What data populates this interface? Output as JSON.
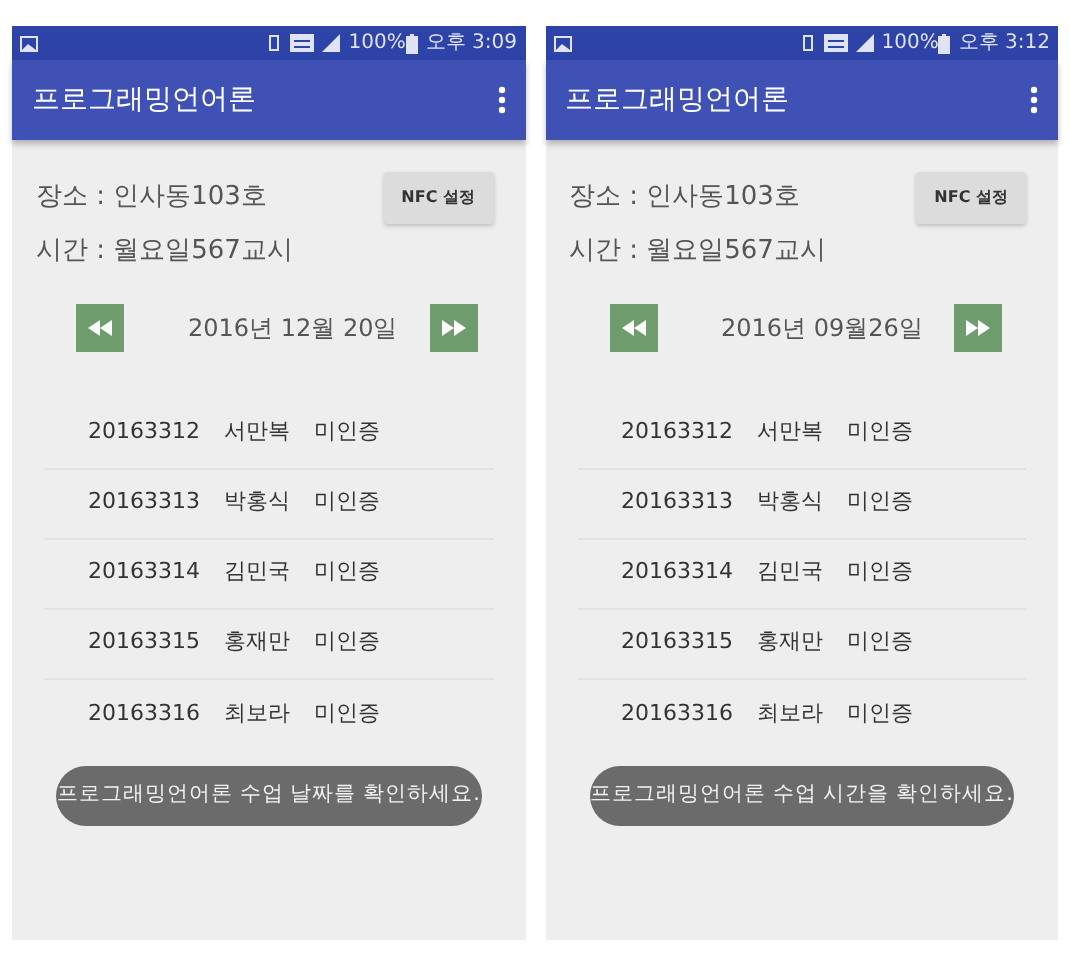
{
  "phones": [
    {
      "status_bar": {
        "battery": "100%",
        "time": "오후 3:09"
      },
      "app_bar": {
        "title": "프로그래밍언어론"
      },
      "place": "장소 : 인사동103호",
      "time": "시간 : 월요일567교시",
      "nfc_button": "NFC 설정",
      "date": "2016년 12월 20일",
      "students": [
        {
          "id": "20163312",
          "name": "서만복",
          "status": "미인증"
        },
        {
          "id": "20163313",
          "name": "박홍식",
          "status": "미인증"
        },
        {
          "id": "20163314",
          "name": "김민국",
          "status": "미인증"
        },
        {
          "id": "20163315",
          "name": "홍재만",
          "status": "미인증"
        },
        {
          "id": "20163316",
          "name": "최보라",
          "status": "미인증"
        }
      ],
      "toast": "프로그래밍언어론 수업 날짜를 확인하세요."
    },
    {
      "status_bar": {
        "battery": "100%",
        "time": "오후 3:12"
      },
      "app_bar": {
        "title": "프로그래밍언어론"
      },
      "place": "장소 : 인사동103호",
      "time": "시간 : 월요일567교시",
      "nfc_button": "NFC 설정",
      "date": "2016년 09월26일",
      "students": [
        {
          "id": "20163312",
          "name": "서만복",
          "status": "미인증"
        },
        {
          "id": "20163313",
          "name": "박홍식",
          "status": "미인증"
        },
        {
          "id": "20163314",
          "name": "김민국",
          "status": "미인증"
        },
        {
          "id": "20163315",
          "name": "홍재만",
          "status": "미인증"
        },
        {
          "id": "20163316",
          "name": "최보라",
          "status": "미인증"
        }
      ],
      "toast": "프로그래밍언어론 수업 시간을 확인하세요."
    }
  ]
}
